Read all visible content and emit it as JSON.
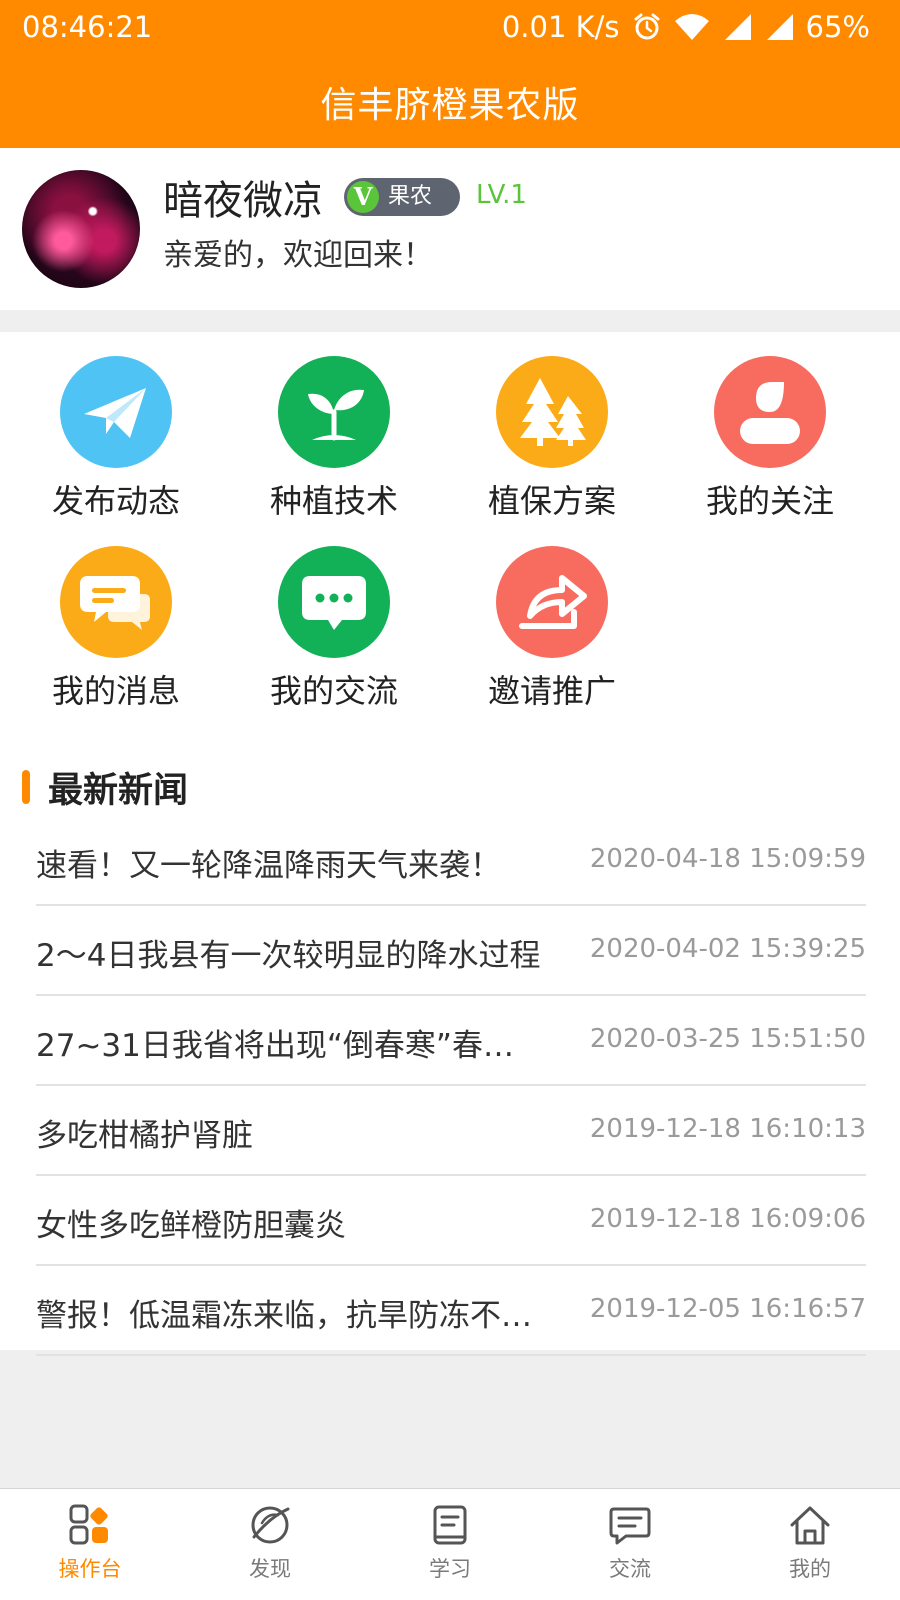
{
  "statusbar": {
    "time": "08:46:21",
    "net_speed": "0.01 K/s",
    "battery": "65%"
  },
  "header": {
    "title": "信丰脐橙果农版"
  },
  "profile": {
    "username": "暗夜微凉",
    "badge_v": "V",
    "badge_label": "果农",
    "level": "LV.1",
    "welcome": "亲爱的，欢迎回来！"
  },
  "grid": {
    "items": [
      {
        "label": "发布动态",
        "icon": "paper-plane-icon",
        "color": "#4ec3f4"
      },
      {
        "label": "种植技术",
        "icon": "sprout-icon",
        "color": "#12b057"
      },
      {
        "label": "植保方案",
        "icon": "trees-icon",
        "color": "#fbab17"
      },
      {
        "label": "我的关注",
        "icon": "person-icon",
        "color": "#f86b5f"
      },
      {
        "label": "我的消息",
        "icon": "chat-bubbles-icon",
        "color": "#fbab17"
      },
      {
        "label": "我的交流",
        "icon": "message-dots-icon",
        "color": "#12b057"
      },
      {
        "label": "邀请推广",
        "icon": "share-arrow-icon",
        "color": "#f86b5f"
      }
    ]
  },
  "news": {
    "title": "最新新闻",
    "items": [
      {
        "text": "速看！又一轮降温降雨天气来袭！",
        "time": "2020-04-18 15:09:59"
      },
      {
        "text": "2～4日我县有一次较明显的降水过程",
        "time": "2020-04-02 15:39:25"
      },
      {
        "text": "27~31日我省将出现“倒春寒”春…",
        "time": "2020-03-25 15:51:50"
      },
      {
        "text": "多吃柑橘护肾脏",
        "time": "2019-12-18 16:10:13"
      },
      {
        "text": "女性多吃鲜橙防胆囊炎",
        "time": "2019-12-18 16:09:06"
      },
      {
        "text": "警报！低温霜冻来临，抗旱防冻不…",
        "time": "2019-12-05 16:16:57"
      }
    ]
  },
  "bottom_nav": {
    "items": [
      {
        "label": "操作台",
        "icon": "dashboard-icon",
        "active": true
      },
      {
        "label": "发现",
        "icon": "planet-icon",
        "active": false
      },
      {
        "label": "学习",
        "icon": "book-icon",
        "active": false
      },
      {
        "label": "交流",
        "icon": "chat-icon",
        "active": false
      },
      {
        "label": "我的",
        "icon": "home-icon",
        "active": false
      }
    ]
  },
  "colors": {
    "primary": "#ff8a00",
    "level_green": "#5ac43a",
    "badge_bg": "#5f6570"
  }
}
